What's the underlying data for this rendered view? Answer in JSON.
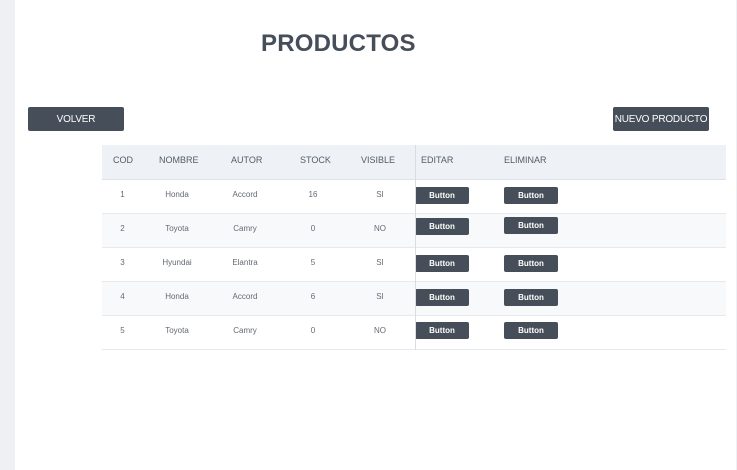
{
  "page": {
    "title": "PRODUCTOS",
    "back_label": "VOLVER",
    "new_label": "NUEVO PRODUCTO"
  },
  "table": {
    "columns": [
      "COD",
      "NOMBRE",
      "AUTOR",
      "STOCK",
      "VISIBLE",
      "EDITAR",
      "ELIMINAR"
    ],
    "rows": [
      {
        "cod": "1",
        "nombre": "Honda",
        "autor": "Accord",
        "stock": "16",
        "visible": "SI",
        "edit": "Button",
        "delete": "Button"
      },
      {
        "cod": "2",
        "nombre": "Toyota",
        "autor": "Camry",
        "stock": "0",
        "visible": "NO",
        "edit": "Button",
        "delete": "Button"
      },
      {
        "cod": "3",
        "nombre": "Hyundai",
        "autor": "Elantra",
        "stock": "5",
        "visible": "SI",
        "edit": "Button",
        "delete": "Button"
      },
      {
        "cod": "4",
        "nombre": "Honda",
        "autor": "Accord",
        "stock": "6",
        "visible": "SI",
        "edit": "Button",
        "delete": "Button"
      },
      {
        "cod": "5",
        "nombre": "Toyota",
        "autor": "Camry",
        "stock": "0",
        "visible": "NO",
        "edit": "Button",
        "delete": "Button"
      }
    ]
  },
  "colors": {
    "primary_dark": "#464e59",
    "header_bg": "#eef1f6",
    "page_bg": "#eef0f4"
  }
}
